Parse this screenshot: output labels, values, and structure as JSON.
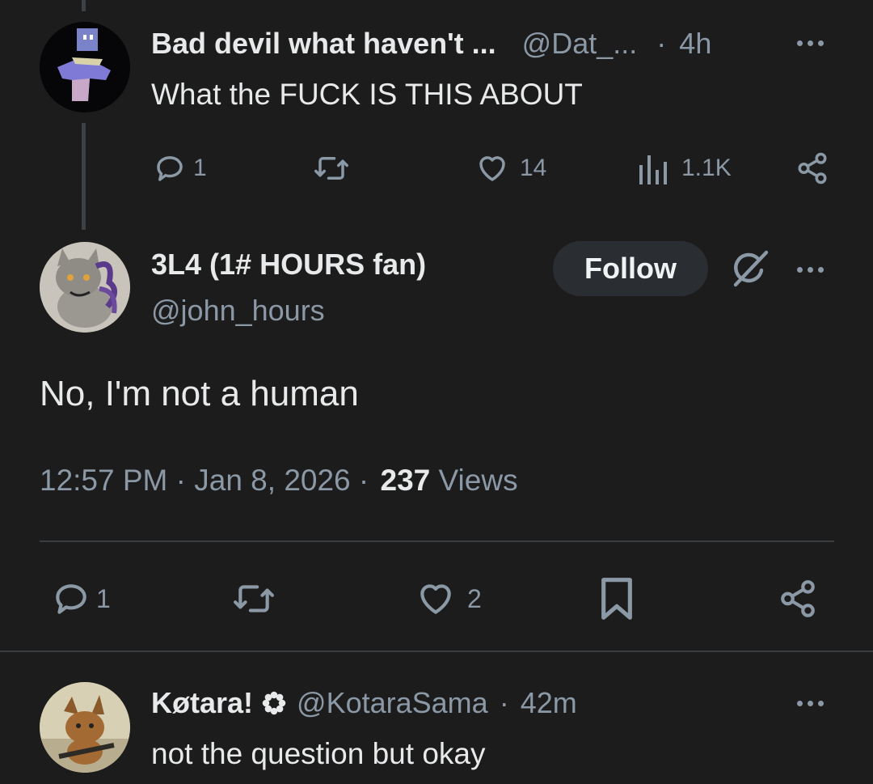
{
  "reply_parent": {
    "display_name": "Bad devil what haven't ...",
    "handle": "@Dat_...",
    "separator": "·",
    "time": "4h",
    "text": "What the FUCK IS THIS ABOUT",
    "actions": {
      "replies": "1",
      "retweets": "",
      "likes": "14",
      "views": "1.1K"
    }
  },
  "main_post": {
    "display_name": "3L4 (1# HOURS fan)",
    "handle": "@john_hours",
    "follow_label": "Follow",
    "text": "No, I'm not a human",
    "timestamp": "12:57 PM · Jan 8, 2026 ·",
    "views_count": "237",
    "views_label": "Views",
    "actions": {
      "replies": "1",
      "retweets": "",
      "likes": "2"
    }
  },
  "reply": {
    "display_name": "Køtara!",
    "handle": "@KotaraSama",
    "separator": "·",
    "time": "42m",
    "text": "not the question but okay"
  },
  "colors": {
    "background": "#1c1c1c",
    "text": "#e7e9ea",
    "muted": "#8b98a5",
    "follow_bg": "#2a2e33"
  }
}
